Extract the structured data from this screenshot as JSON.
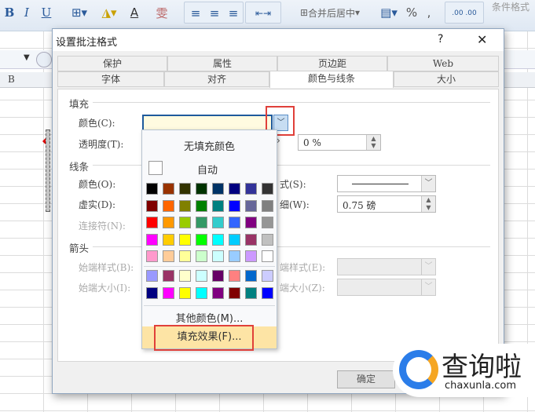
{
  "ribbon": {
    "bold": "B",
    "italic": "I",
    "underline": "U",
    "merge_center": "合并后居中",
    "percent": "%",
    "comma": ",",
    "conditional_format": "条件格式"
  },
  "sheet": {
    "column_b": "B"
  },
  "dialog": {
    "title": "设置批注格式",
    "help": "?",
    "close": "✕",
    "tabs_row1": [
      "保护",
      "属性",
      "页边距",
      "Web"
    ],
    "tabs_row2": [
      "字体",
      "对齐",
      "颜色与线条",
      "大小"
    ],
    "active_tab": "颜色与线条",
    "fill": {
      "section": "填充",
      "color_label": "颜色(C):",
      "color_value": "#fffbe0",
      "transparency_label": "透明度(T):",
      "transparency_value": "0 %"
    },
    "line": {
      "section": "线条",
      "color_label": "颜色(O):",
      "dash_label": "虚实(D):",
      "connector_label": "连接符(N):",
      "style_label": "式(S):",
      "weight_label": "细(W):",
      "weight_value": "0.75 磅"
    },
    "arrows": {
      "section": "箭头",
      "begin_style": "始端样式(B):",
      "begin_size": "始端大小(I):",
      "end_style": "端样式(E):",
      "end_size": "端大小(Z):"
    },
    "ok": "确定"
  },
  "color_popup": {
    "no_fill": "无填充颜色",
    "automatic": "自动",
    "more_colors": "其他颜色(M)...",
    "fill_effects": "填充效果(F)...",
    "palette": [
      [
        "#000000",
        "#993300",
        "#333300",
        "#003300",
        "#003366",
        "#000080",
        "#333399",
        "#333333"
      ],
      [
        "#800000",
        "#FF6600",
        "#808000",
        "#008000",
        "#008080",
        "#0000FF",
        "#666699",
        "#808080"
      ],
      [
        "#FF0000",
        "#FF9900",
        "#99CC00",
        "#339966",
        "#33CCCC",
        "#3366FF",
        "#800080",
        "#969696"
      ],
      [
        "#FF00FF",
        "#FFCC00",
        "#FFFF00",
        "#00FF00",
        "#00FFFF",
        "#00CCFF",
        "#993366",
        "#C0C0C0"
      ],
      [
        "#FF99CC",
        "#FFCC99",
        "#FFFF99",
        "#CCFFCC",
        "#CCFFFF",
        "#99CCFF",
        "#CC99FF",
        "#FFFFFF"
      ]
    ],
    "chart_colors": [
      [
        "#9999FF",
        "#993366",
        "#FFFFCC",
        "#CCFFFF",
        "#660066",
        "#FF8080",
        "#0066CC",
        "#CCCCFF"
      ],
      [
        "#000080",
        "#FF00FF",
        "#FFFF00",
        "#00FFFF",
        "#800080",
        "#800000",
        "#008080",
        "#0000FF"
      ]
    ],
    "highlight_color": "#fde4a5",
    "annotation_color": "#e0403a"
  },
  "watermark": {
    "brand": "查询啦",
    "url": "chaxunla.com"
  }
}
